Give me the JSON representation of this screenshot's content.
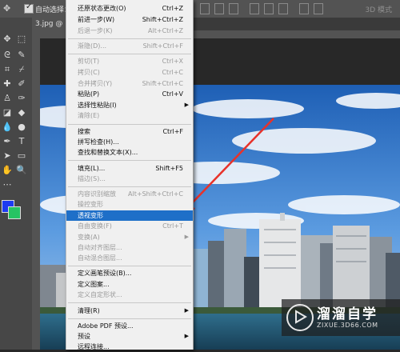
{
  "options_bar": {
    "auto_select_label": "自动选择：",
    "mode_3d_label": "3D 模式"
  },
  "document_tab": {
    "title": "3.jpg @ 75..."
  },
  "menu": {
    "items": [
      {
        "label": "还原状态更改(O)",
        "shortcut": "Ctrl+Z",
        "enabled": true
      },
      {
        "label": "前进一步(W)",
        "shortcut": "Shift+Ctrl+Z",
        "enabled": true
      },
      {
        "label": "后退一步(K)",
        "shortcut": "Alt+Ctrl+Z",
        "enabled": false
      },
      {
        "label": "渐隐(D)...",
        "shortcut": "Shift+Ctrl+F",
        "enabled": false
      },
      {
        "label": "剪切(T)",
        "shortcut": "Ctrl+X",
        "enabled": false
      },
      {
        "label": "拷贝(C)",
        "shortcut": "Ctrl+C",
        "enabled": false
      },
      {
        "label": "合并拷贝(Y)",
        "shortcut": "Shift+Ctrl+C",
        "enabled": false
      },
      {
        "label": "粘贴(P)",
        "shortcut": "Ctrl+V",
        "enabled": true
      },
      {
        "label": "选择性粘贴(I)",
        "shortcut": "",
        "enabled": true,
        "submenu": true
      },
      {
        "label": "清除(E)",
        "shortcut": "",
        "enabled": false
      },
      {
        "label": "搜索",
        "shortcut": "Ctrl+F",
        "enabled": true
      },
      {
        "label": "拼写检查(H)...",
        "shortcut": "",
        "enabled": true
      },
      {
        "label": "查找和替换文本(X)...",
        "shortcut": "",
        "enabled": true
      },
      {
        "label": "填充(L)...",
        "shortcut": "Shift+F5",
        "enabled": true
      },
      {
        "label": "描边(S)...",
        "shortcut": "",
        "enabled": false
      },
      {
        "label": "内容识别缩放",
        "shortcut": "Alt+Shift+Ctrl+C",
        "enabled": false
      },
      {
        "label": "操控变形",
        "shortcut": "",
        "enabled": false
      },
      {
        "label": "透视变形",
        "shortcut": "",
        "enabled": true,
        "selected": true
      },
      {
        "label": "自由变换(F)",
        "shortcut": "Ctrl+T",
        "enabled": false
      },
      {
        "label": "变换(A)",
        "shortcut": "",
        "enabled": false,
        "submenu": true
      },
      {
        "label": "自动对齐图层...",
        "shortcut": "",
        "enabled": false
      },
      {
        "label": "自动混合图层...",
        "shortcut": "",
        "enabled": false
      },
      {
        "label": "定义画笔预设(B)...",
        "shortcut": "",
        "enabled": true
      },
      {
        "label": "定义图案...",
        "shortcut": "",
        "enabled": true
      },
      {
        "label": "定义自定形状...",
        "shortcut": "",
        "enabled": false
      },
      {
        "label": "清理(R)",
        "shortcut": "",
        "enabled": true,
        "submenu": true
      },
      {
        "label": "Adobe PDF 预设...",
        "shortcut": "",
        "enabled": true
      },
      {
        "label": "预设",
        "shortcut": "",
        "enabled": true,
        "submenu": true
      },
      {
        "label": "远程连接...",
        "shortcut": "",
        "enabled": true
      }
    ]
  },
  "colors": {
    "foreground": "#1d3cf2",
    "background": "#27c463",
    "menu_highlight": "#1e6fc8",
    "annotation_arrow": "#e8322a"
  },
  "watermark": {
    "title": "溜溜自学",
    "url": "ZIXUE.3D66.COM"
  }
}
